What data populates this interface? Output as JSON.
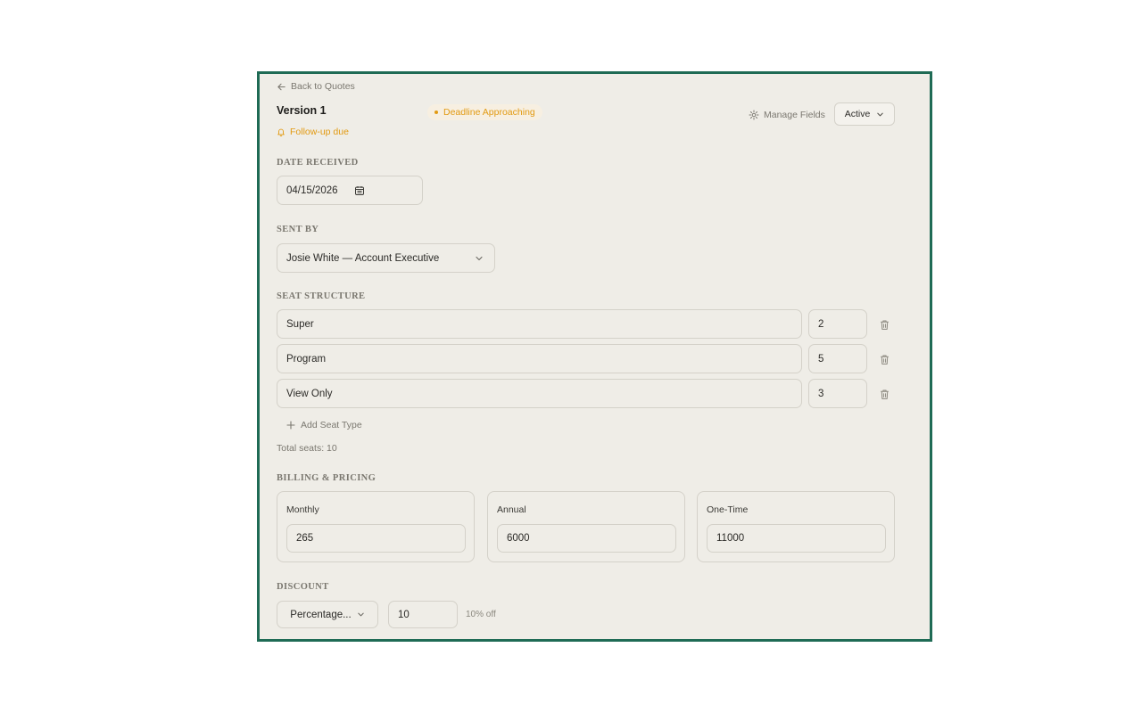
{
  "header": {
    "back_label": "Back to Quotes",
    "version_title": "Version 1",
    "deadline_badge": "Deadline Approaching",
    "followup_label": "Follow-up due",
    "manage_fields_label": "Manage Fields",
    "status_value": "Active"
  },
  "date_received": {
    "label": "DATE RECEIVED",
    "value": "04/15/2026"
  },
  "sent_by": {
    "label": "SENT BY",
    "value": "Josie White — Account Executive"
  },
  "seat_structure": {
    "label": "SEAT STRUCTURE",
    "rows": [
      {
        "name": "Super",
        "count": "2"
      },
      {
        "name": "Program",
        "count": "5"
      },
      {
        "name": "View Only",
        "count": "3"
      }
    ],
    "add_label": "Add Seat Type",
    "total_label": "Total seats: 10"
  },
  "billing": {
    "label": "BILLING & PRICING",
    "cards": [
      {
        "label": "Monthly",
        "value": "265"
      },
      {
        "label": "Annual",
        "value": "6000"
      },
      {
        "label": "One-Time",
        "value": "11000"
      }
    ]
  },
  "discount": {
    "label": "DISCOUNT",
    "type_value": "Percentage...",
    "amount_value": "10",
    "note": "10% off"
  },
  "colors": {
    "frame_border": "#1f6b55",
    "panel_bg": "#efede7",
    "warning": "#e29a12",
    "muted_text": "#7a776f"
  }
}
